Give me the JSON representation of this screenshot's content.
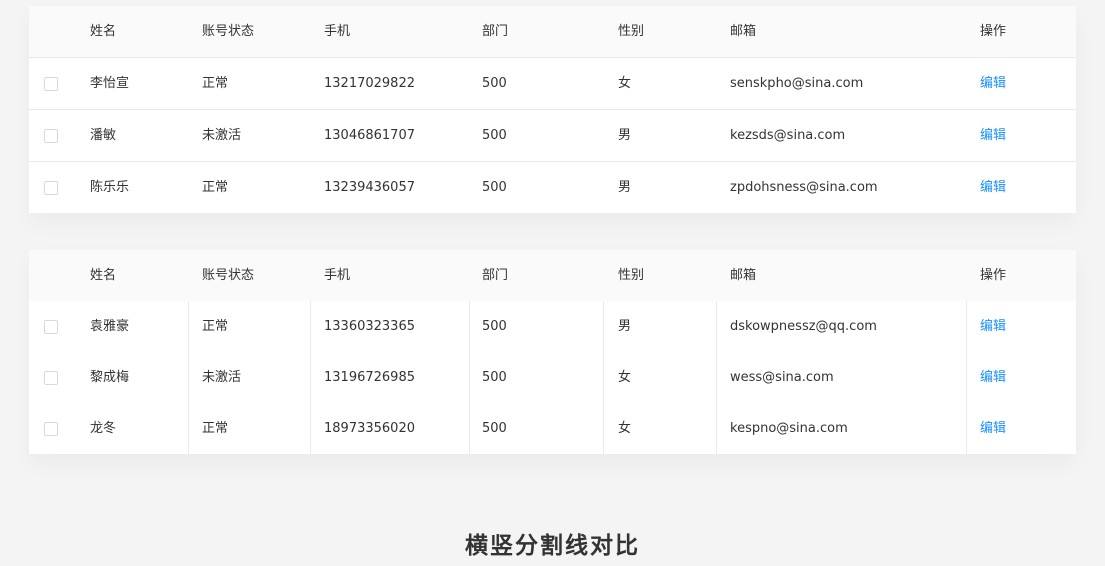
{
  "columns": {
    "name": "姓名",
    "status": "账号状态",
    "phone": "手机",
    "dept": "部门",
    "gender": "性别",
    "email": "邮箱",
    "action": "操作"
  },
  "table_horizontal": {
    "rows": [
      {
        "name": "李怡宣",
        "status": "正常",
        "phone": "13217029822",
        "dept": "500",
        "gender": "女",
        "email": "senskpho@sina.com",
        "action": "编辑"
      },
      {
        "name": "潘敏",
        "status": "未激活",
        "phone": "13046861707",
        "dept": "500",
        "gender": "男",
        "email": "kezsds@sina.com",
        "action": "编辑"
      },
      {
        "name": "陈乐乐",
        "status": "正常",
        "phone": "13239436057",
        "dept": "500",
        "gender": "男",
        "email": "zpdohsness@sina.com",
        "action": "编辑"
      }
    ]
  },
  "table_vertical": {
    "rows": [
      {
        "name": "袁雅豪",
        "status": "正常",
        "phone": "13360323365",
        "dept": "500",
        "gender": "男",
        "email": "dskowpnessz@qq.com",
        "action": "编辑"
      },
      {
        "name": "黎成梅",
        "status": "未激活",
        "phone": "13196726985",
        "dept": "500",
        "gender": "女",
        "email": "wess@sina.com",
        "action": "编辑"
      },
      {
        "name": "龙冬",
        "status": "正常",
        "phone": "18973356020",
        "dept": "500",
        "gender": "女",
        "email": "kespno@sina.com",
        "action": "编辑"
      }
    ]
  },
  "caption": "横竖分割线对比",
  "colors": {
    "link": "#1890ff",
    "header_bg": "#fafafa",
    "divider": "#e9e9e9",
    "page_bg": "#f4f4f5"
  }
}
